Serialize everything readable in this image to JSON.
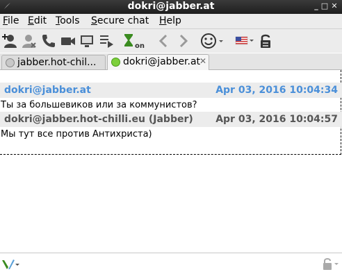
{
  "window": {
    "title": "dokri@jabber.at"
  },
  "menu": [
    {
      "label": "File"
    },
    {
      "label": "Edit"
    },
    {
      "label": "Tools"
    },
    {
      "label": "Secure chat"
    },
    {
      "label": "Help"
    }
  ],
  "toolbar": {
    "icons": [
      "add-contact-icon",
      "remove-contact-icon",
      "call-icon",
      "video-icon",
      "screen-share-icon",
      "send-file-icon",
      "timer-on-icon",
      "back-icon",
      "forward-icon",
      "emoticon-icon",
      "language-flag-icon",
      "lock-icon"
    ],
    "timer_label": "on"
  },
  "tabs": [
    {
      "label": "jabber.hot-chil...",
      "status": "offline",
      "active": false
    },
    {
      "label": "dokri@jabber.at",
      "status": "online",
      "active": true
    }
  ],
  "messages": [
    {
      "sender": "dokri@jabber.at",
      "time": "Apr 03, 2016 10:04:34",
      "text": "Ты за большевиков или за коммунистов?",
      "sender_color": "#4a8fd9"
    },
    {
      "sender": "dokri@jabber.hot-chilli.eu (Jabber)",
      "time": "Apr 03, 2016 10:04:57",
      "text": "Мы тут все против Антихриста)",
      "sender_color": "#555555"
    }
  ],
  "colors": {
    "accent": "#4a8fd9",
    "online": "#7ccf3a",
    "offline": "#c8c8c8"
  }
}
